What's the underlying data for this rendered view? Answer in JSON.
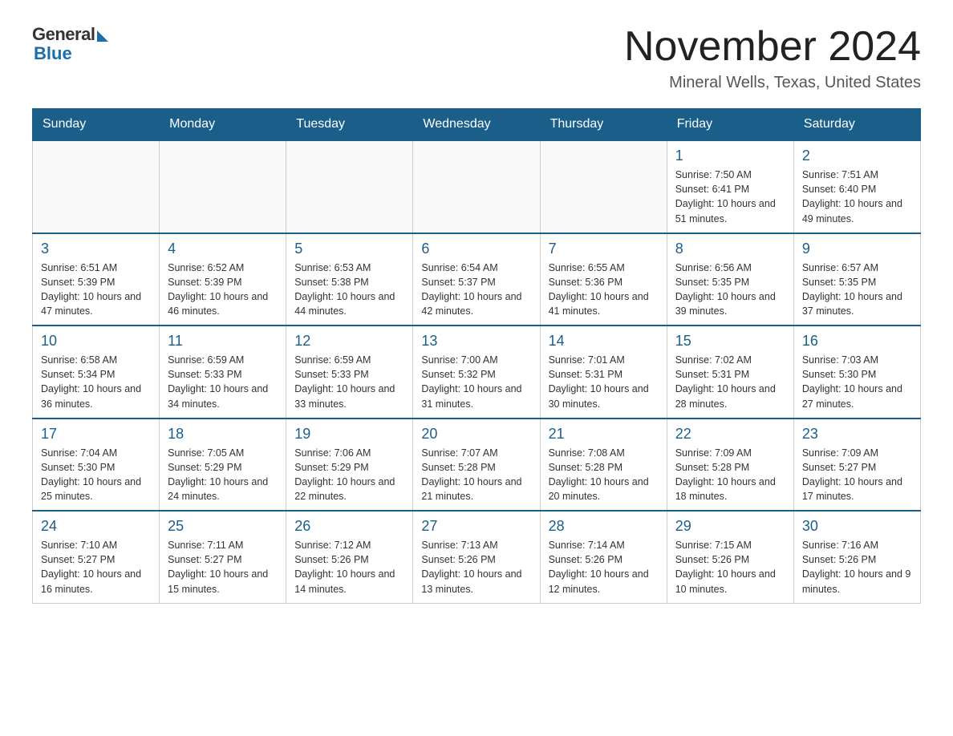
{
  "header": {
    "logo_general": "General",
    "logo_blue": "Blue",
    "main_title": "November 2024",
    "subtitle": "Mineral Wells, Texas, United States"
  },
  "weekdays": [
    "Sunday",
    "Monday",
    "Tuesday",
    "Wednesday",
    "Thursday",
    "Friday",
    "Saturday"
  ],
  "weeks": [
    [
      {
        "day": "",
        "info": ""
      },
      {
        "day": "",
        "info": ""
      },
      {
        "day": "",
        "info": ""
      },
      {
        "day": "",
        "info": ""
      },
      {
        "day": "",
        "info": ""
      },
      {
        "day": "1",
        "info": "Sunrise: 7:50 AM\nSunset: 6:41 PM\nDaylight: 10 hours and 51 minutes."
      },
      {
        "day": "2",
        "info": "Sunrise: 7:51 AM\nSunset: 6:40 PM\nDaylight: 10 hours and 49 minutes."
      }
    ],
    [
      {
        "day": "3",
        "info": "Sunrise: 6:51 AM\nSunset: 5:39 PM\nDaylight: 10 hours and 47 minutes."
      },
      {
        "day": "4",
        "info": "Sunrise: 6:52 AM\nSunset: 5:39 PM\nDaylight: 10 hours and 46 minutes."
      },
      {
        "day": "5",
        "info": "Sunrise: 6:53 AM\nSunset: 5:38 PM\nDaylight: 10 hours and 44 minutes."
      },
      {
        "day": "6",
        "info": "Sunrise: 6:54 AM\nSunset: 5:37 PM\nDaylight: 10 hours and 42 minutes."
      },
      {
        "day": "7",
        "info": "Sunrise: 6:55 AM\nSunset: 5:36 PM\nDaylight: 10 hours and 41 minutes."
      },
      {
        "day": "8",
        "info": "Sunrise: 6:56 AM\nSunset: 5:35 PM\nDaylight: 10 hours and 39 minutes."
      },
      {
        "day": "9",
        "info": "Sunrise: 6:57 AM\nSunset: 5:35 PM\nDaylight: 10 hours and 37 minutes."
      }
    ],
    [
      {
        "day": "10",
        "info": "Sunrise: 6:58 AM\nSunset: 5:34 PM\nDaylight: 10 hours and 36 minutes."
      },
      {
        "day": "11",
        "info": "Sunrise: 6:59 AM\nSunset: 5:33 PM\nDaylight: 10 hours and 34 minutes."
      },
      {
        "day": "12",
        "info": "Sunrise: 6:59 AM\nSunset: 5:33 PM\nDaylight: 10 hours and 33 minutes."
      },
      {
        "day": "13",
        "info": "Sunrise: 7:00 AM\nSunset: 5:32 PM\nDaylight: 10 hours and 31 minutes."
      },
      {
        "day": "14",
        "info": "Sunrise: 7:01 AM\nSunset: 5:31 PM\nDaylight: 10 hours and 30 minutes."
      },
      {
        "day": "15",
        "info": "Sunrise: 7:02 AM\nSunset: 5:31 PM\nDaylight: 10 hours and 28 minutes."
      },
      {
        "day": "16",
        "info": "Sunrise: 7:03 AM\nSunset: 5:30 PM\nDaylight: 10 hours and 27 minutes."
      }
    ],
    [
      {
        "day": "17",
        "info": "Sunrise: 7:04 AM\nSunset: 5:30 PM\nDaylight: 10 hours and 25 minutes."
      },
      {
        "day": "18",
        "info": "Sunrise: 7:05 AM\nSunset: 5:29 PM\nDaylight: 10 hours and 24 minutes."
      },
      {
        "day": "19",
        "info": "Sunrise: 7:06 AM\nSunset: 5:29 PM\nDaylight: 10 hours and 22 minutes."
      },
      {
        "day": "20",
        "info": "Sunrise: 7:07 AM\nSunset: 5:28 PM\nDaylight: 10 hours and 21 minutes."
      },
      {
        "day": "21",
        "info": "Sunrise: 7:08 AM\nSunset: 5:28 PM\nDaylight: 10 hours and 20 minutes."
      },
      {
        "day": "22",
        "info": "Sunrise: 7:09 AM\nSunset: 5:28 PM\nDaylight: 10 hours and 18 minutes."
      },
      {
        "day": "23",
        "info": "Sunrise: 7:09 AM\nSunset: 5:27 PM\nDaylight: 10 hours and 17 minutes."
      }
    ],
    [
      {
        "day": "24",
        "info": "Sunrise: 7:10 AM\nSunset: 5:27 PM\nDaylight: 10 hours and 16 minutes."
      },
      {
        "day": "25",
        "info": "Sunrise: 7:11 AM\nSunset: 5:27 PM\nDaylight: 10 hours and 15 minutes."
      },
      {
        "day": "26",
        "info": "Sunrise: 7:12 AM\nSunset: 5:26 PM\nDaylight: 10 hours and 14 minutes."
      },
      {
        "day": "27",
        "info": "Sunrise: 7:13 AM\nSunset: 5:26 PM\nDaylight: 10 hours and 13 minutes."
      },
      {
        "day": "28",
        "info": "Sunrise: 7:14 AM\nSunset: 5:26 PM\nDaylight: 10 hours and 12 minutes."
      },
      {
        "day": "29",
        "info": "Sunrise: 7:15 AM\nSunset: 5:26 PM\nDaylight: 10 hours and 10 minutes."
      },
      {
        "day": "30",
        "info": "Sunrise: 7:16 AM\nSunset: 5:26 PM\nDaylight: 10 hours and 9 minutes."
      }
    ]
  ]
}
